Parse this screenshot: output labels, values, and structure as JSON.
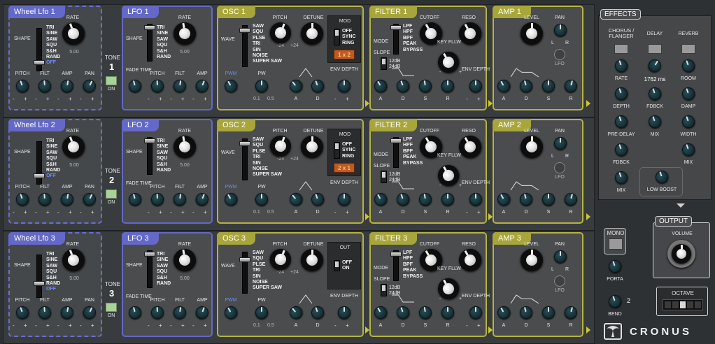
{
  "tones": [
    {
      "wheel_title": "Wheel Lfo 1",
      "lfo_title": "LFO 1",
      "osc_title": "OSC 1",
      "filter_title": "FILTER 1",
      "amp_title": "AMP 1",
      "tone_label": "TONE",
      "tone_num": "1",
      "on": "ON",
      "osc_box_title": "MOD",
      "osc_box_opts": [
        "OFF",
        "SYNC",
        "RING"
      ],
      "osc_badge": "1 x 2"
    },
    {
      "wheel_title": "Wheel Lfo 2",
      "lfo_title": "LFO 2",
      "osc_title": "OSC 2",
      "filter_title": "FILTER 2",
      "amp_title": "AMP 2",
      "tone_label": "TONE",
      "tone_num": "2",
      "on": "ON",
      "osc_box_title": "MOD",
      "osc_box_opts": [
        "OFF",
        "SYNC",
        "RING"
      ],
      "osc_badge": "2 x 1"
    },
    {
      "wheel_title": "Wheel Lfo 3",
      "lfo_title": "LFO 3",
      "osc_title": "OSC 3",
      "filter_title": "FILTER 3",
      "amp_title": "AMP 3",
      "tone_label": "TONE",
      "tone_num": "3",
      "on": "ON",
      "osc_box_title": "OUT",
      "osc_box_opts": [
        "OFF",
        "ON"
      ],
      "osc_badge": ""
    }
  ],
  "labels": {
    "rate": "RATE",
    "shape": "SHAPE",
    "rate_val": "5.00",
    "wheel_shapes": [
      "TRI",
      "SINE",
      "SAW",
      "SQU",
      "S&H",
      "RAND",
      "OFF"
    ],
    "lfo_shapes": [
      "TRI",
      "SINE",
      "SAW",
      "SQU",
      "S&H",
      "RAND"
    ],
    "pitch": "PITCH",
    "filt": "FILT",
    "amp": "AMP",
    "pan": "PAN",
    "fade_time": "FADE TIME",
    "wave": "WAVE",
    "detune": "DETUNE",
    "osc_waves": [
      "SAW",
      "SQU",
      "PLSE",
      "TRI",
      "SIN",
      "NOISE",
      "SUPER SAW"
    ],
    "minus24": "-24",
    "plus24": "+24",
    "pwm": "PWM",
    "pw": "PW",
    "pw_min": "0.1",
    "pw_max": "0.5",
    "a": "A",
    "d": "D",
    "s": "S",
    "r": "R",
    "env_depth": "ENV DEPTH",
    "mode": "MODE",
    "slope": "SLOPE",
    "cutoff": "CUTOFF",
    "reso": "RESO",
    "key_fllw": "KEY FLLW",
    "filter_modes": [
      "LPF",
      "HPF",
      "BPF",
      "PEAK",
      "BYPASS"
    ],
    "slopes": [
      "12dB",
      "24dB"
    ],
    "level": "LEVEL",
    "l": "L",
    "r_pan": "R",
    "lfo": "LFO",
    "minus": "-",
    "plus": "+"
  },
  "effects": {
    "title": "EFFECTS",
    "chorus": "CHORUS / FLANGER",
    "delay": "DELAY",
    "reverb": "REVERB",
    "rate": "RATE",
    "delay_val": "1762 ms",
    "room": "ROOM",
    "depth": "DEPTH",
    "fdbck": "FDBCK",
    "damp": "DAMP",
    "pre_delay": "PRE-DELAY",
    "mix": "MIX",
    "width": "WIDTH",
    "low_boost": "LOW BOOST"
  },
  "output": {
    "title": "OUTPUT",
    "volume": "VOLUME"
  },
  "global": {
    "mono": "MONO",
    "porta": "PORTA",
    "bend": "BEND",
    "bend_val": "2",
    "octave": "OCTAVE",
    "brand": "CRONUS"
  },
  "colors": {
    "lfo_blue": "#6468c8",
    "olive": "#b5b340",
    "on_green": "#a9d29a",
    "badge_orange": "#c05a20"
  }
}
